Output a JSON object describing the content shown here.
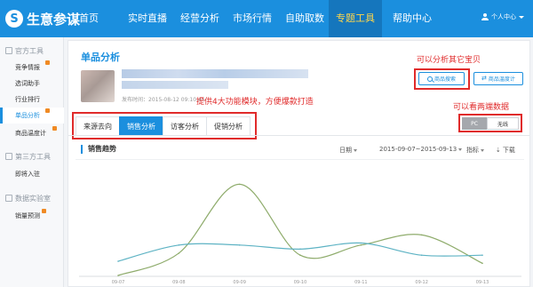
{
  "app": {
    "logo_glyph": "S",
    "name": "生意参谋"
  },
  "nav": {
    "items": [
      {
        "label": "首页"
      },
      {
        "label": "实时直播"
      },
      {
        "label": "经营分析"
      },
      {
        "label": "市场行情"
      },
      {
        "label": "自助取数"
      },
      {
        "label": "专题工具",
        "active": true
      },
      {
        "label": "帮助中心"
      }
    ],
    "user_label": "个人中心"
  },
  "sidebar": {
    "groups": [
      {
        "title": "官方工具"
      },
      {
        "title": "第三方工具"
      },
      {
        "title": "数据实验室"
      }
    ],
    "items": [
      {
        "label": "竞争情报"
      },
      {
        "label": "选词助手"
      },
      {
        "label": "行业排行"
      },
      {
        "label": "单品分析",
        "active": true
      },
      {
        "label": "商品温度计"
      },
      {
        "label": "即将入驻"
      },
      {
        "label": "销量预测"
      }
    ]
  },
  "main": {
    "title": "单品分析",
    "publish_time": "发布时间：2015-08-12 09:10:45",
    "buttons": {
      "search": "商品搜索",
      "thermometer": "商品温度计"
    },
    "annotations": {
      "search_others": "可以分析其它宝贝",
      "tabs": "提供4大功能模块，方便爆款打造",
      "two_ends": "可以看两端数据"
    },
    "terminal": {
      "pc": "PC",
      "wireless": "无线"
    },
    "tabs": [
      {
        "label": "来源去向"
      },
      {
        "label": "销售分析",
        "active": true
      },
      {
        "label": "访客分析"
      },
      {
        "label": "促销分析"
      }
    ],
    "trend": {
      "title": "销售趋势",
      "date_label": "日期",
      "date_range": "2015-09-07~2015-09-13",
      "metric_label": "指标",
      "download_label": "下载"
    }
  },
  "colors": {
    "brand": "#1b8fde",
    "annotation": "#e02b2b",
    "series_green": "#8fac6c",
    "series_teal": "#5eb3c4"
  },
  "chart_data": {
    "type": "line",
    "title": "销售趋势",
    "x": [
      "09-07",
      "09-08",
      "09-09",
      "09-10",
      "09-11",
      "09-12",
      "09-13"
    ],
    "series": [
      {
        "values": [
          0,
          22,
          90,
          20,
          30,
          40,
          12
        ]
      },
      {
        "values": [
          14,
          30,
          30,
          26,
          32,
          20,
          20
        ]
      }
    ],
    "ylim": [
      0,
      100
    ],
    "grid": false,
    "legend": "none"
  }
}
